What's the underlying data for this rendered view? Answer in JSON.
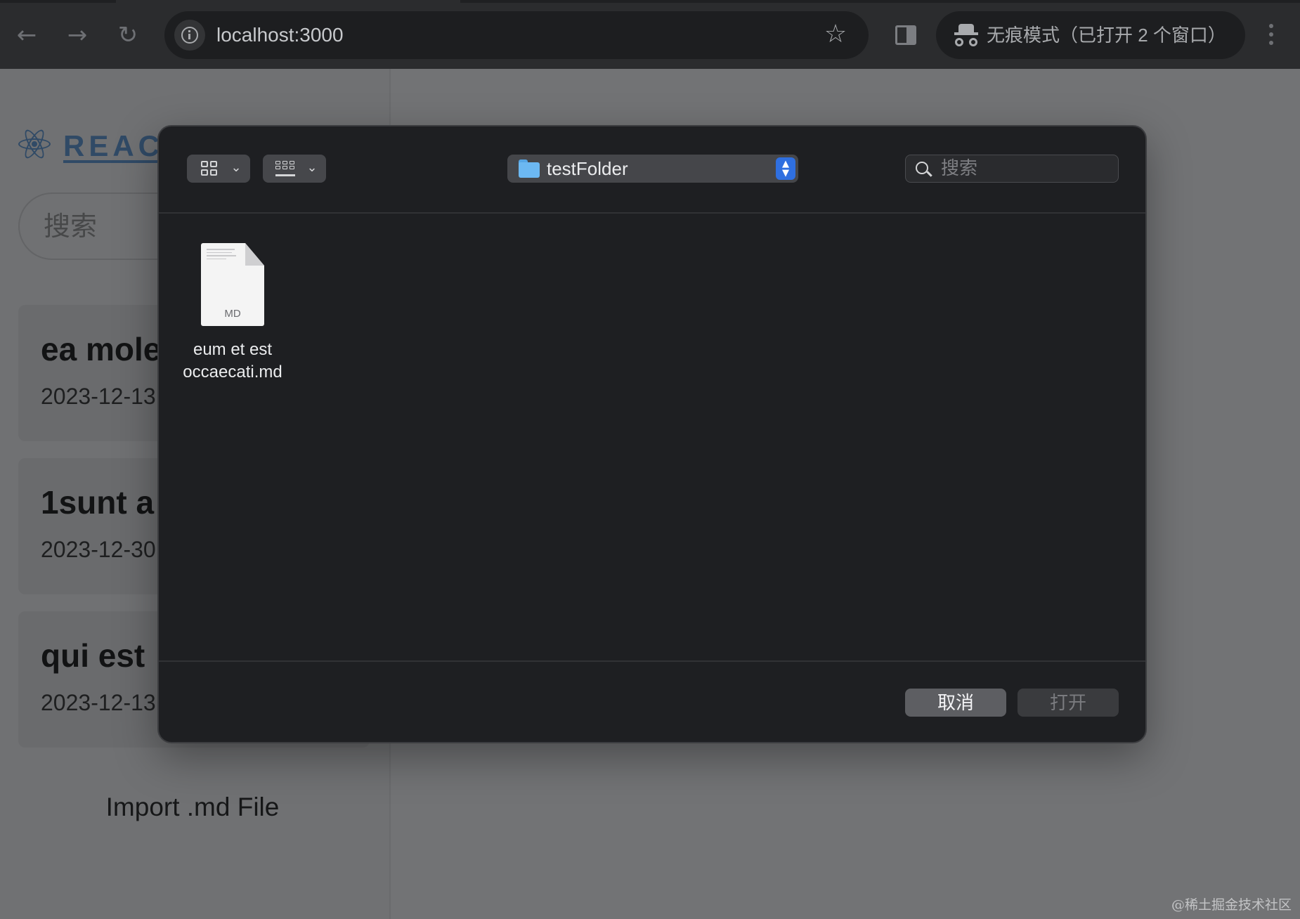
{
  "browser": {
    "url": "localhost:3000",
    "incognito_label": "无痕模式（已打开 2 个窗口）"
  },
  "app": {
    "brand": "REACT",
    "search_placeholder": "搜索",
    "notes": [
      {
        "title": "ea mole",
        "date": "2023-12-13"
      },
      {
        "title": "1sunt a",
        "date": "2023-12-30"
      },
      {
        "title": "qui est",
        "date": "2023-12-13"
      }
    ],
    "import_label": "Import .md File"
  },
  "dialog": {
    "path": "testFolder",
    "search_placeholder": "搜索",
    "files": [
      {
        "type": "MD",
        "name_line1": "eum et est",
        "name_line2": "occaecati.md"
      }
    ],
    "cancel_label": "取消",
    "open_label": "打开"
  },
  "watermark": "@稀土掘金技术社区"
}
